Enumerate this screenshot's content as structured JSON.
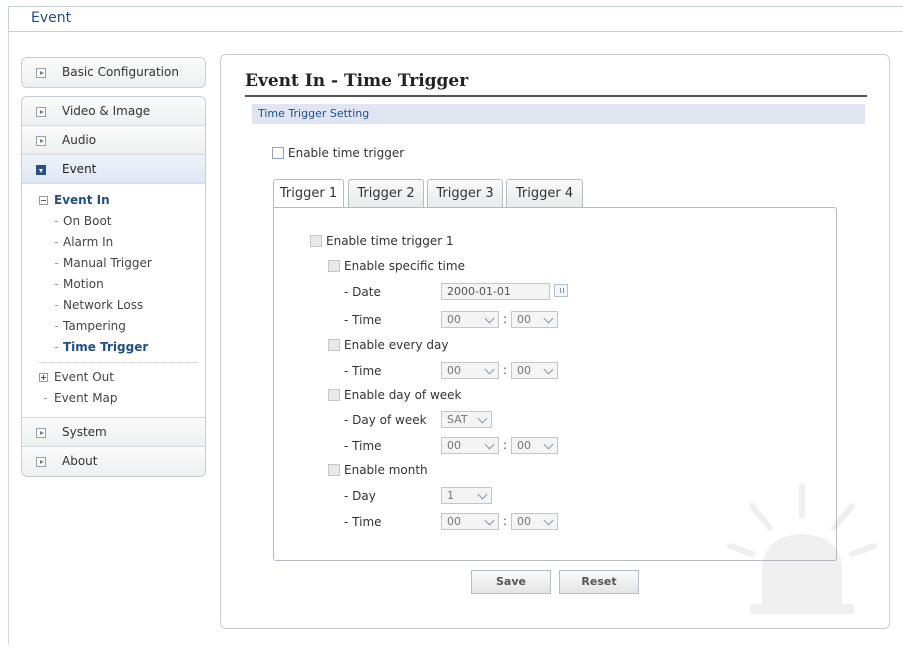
{
  "window": {
    "title": "Event"
  },
  "sidebar": {
    "basic": "Basic Configuration",
    "video": "Video & Image",
    "audio": "Audio",
    "event": "Event",
    "event_in": "Event In",
    "event_in_items": [
      "On Boot",
      "Alarm In",
      "Manual Trigger",
      "Motion",
      "Network Loss",
      "Tampering",
      "Time Trigger"
    ],
    "event_out": "Event Out",
    "event_map": "Event Map",
    "system": "System",
    "about": "About"
  },
  "main": {
    "title": "Event In - Time Trigger",
    "section": "Time Trigger Setting",
    "enable_time_trigger": "Enable time trigger",
    "tabs": [
      "Trigger 1",
      "Trigger 2",
      "Trigger 3",
      "Trigger 4"
    ],
    "trigger": {
      "enable": "Enable time trigger 1",
      "specific": {
        "label": "Enable specific time",
        "date_label": "- Date",
        "date_value": "2000-01-01",
        "time_label": "- Time",
        "hour": "00",
        "minute": "00"
      },
      "everyday": {
        "label": "Enable every day",
        "time_label": "- Time",
        "hour": "00",
        "minute": "00"
      },
      "dayofweek": {
        "label": "Enable day of week",
        "dow_label": "- Day of week",
        "dow_value": "SAT",
        "time_label": "- Time",
        "hour": "00",
        "minute": "00"
      },
      "month": {
        "label": "Enable month",
        "day_label": "- Day",
        "day_value": "1",
        "time_label": "- Time",
        "hour": "00",
        "minute": "00"
      }
    },
    "save": "Save",
    "reset": "Reset",
    "colon": ":"
  },
  "colors": {
    "accent": "#1f4e8c",
    "section_bg": "#dfe6f1"
  }
}
